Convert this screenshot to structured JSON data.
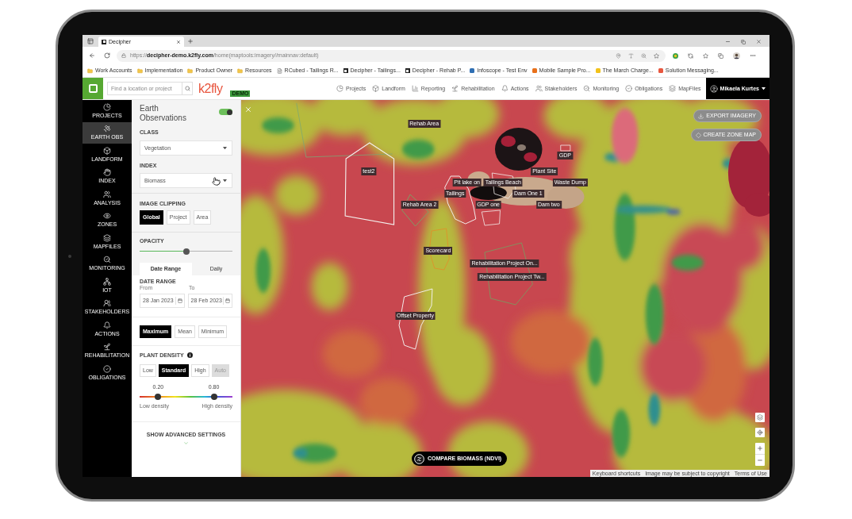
{
  "browser": {
    "tabs": [
      {
        "title": "Decipher",
        "selected": true
      }
    ],
    "url": "https://**decipher-demo.k2fly.com**/home(maptools:imagery//mainnav:default)",
    "bookmarks": [
      {
        "label": "Work Accounts",
        "kind": "folder"
      },
      {
        "label": "Implementation",
        "kind": "folder"
      },
      {
        "label": "Product Owner",
        "kind": "folder"
      },
      {
        "label": "Resources",
        "kind": "folder"
      },
      {
        "label": "RCubed - Tailings R...",
        "kind": "page"
      },
      {
        "label": "Decipher - Tailings...",
        "kind": "app"
      },
      {
        "label": "Decipher - Rehab P...",
        "kind": "app"
      },
      {
        "label": "Infoscope - Test Env",
        "kind": "favicon",
        "color": "#2f6fb3"
      },
      {
        "label": "Mobile Sample Pro...",
        "kind": "favicon",
        "color": "#e8701a"
      },
      {
        "label": "The March Charge...",
        "kind": "favicon",
        "color": "#f2c21b"
      },
      {
        "label": "Solution Messaging...",
        "kind": "favicon",
        "color": "#e8573f"
      }
    ]
  },
  "app_bar": {
    "search": {
      "placeholder": "Find a location or project"
    },
    "logo": "k2fly",
    "badge": "DEMO",
    "nav": [
      {
        "label": "Projects"
      },
      {
        "label": "Landform"
      },
      {
        "label": "Reporting"
      },
      {
        "label": "Rehabilitation"
      },
      {
        "label": "Actions"
      },
      {
        "label": "Stakeholders"
      },
      {
        "label": "Monitoring"
      },
      {
        "label": "Obligations"
      },
      {
        "label": "MapFiles"
      }
    ],
    "user": {
      "name": "Mikaela Kurtes"
    }
  },
  "sidebar": {
    "items": [
      {
        "label": "PROJECTS",
        "selected": false
      },
      {
        "label": "EARTH OBS",
        "selected": true
      },
      {
        "label": "LANDFORM",
        "selected": false
      },
      {
        "label": "INDEX",
        "selected": false
      },
      {
        "label": "ANALYSIS",
        "selected": false
      },
      {
        "label": "ZONES",
        "selected": false
      },
      {
        "label": "MAPFILES",
        "selected": false
      },
      {
        "label": "MONITORING",
        "selected": false
      },
      {
        "label": "IOT",
        "selected": false
      },
      {
        "label": "STAKEHOLDERS",
        "selected": false
      },
      {
        "label": "ACTIONS",
        "selected": false
      },
      {
        "label": "REHABILITATION",
        "selected": false
      },
      {
        "label": "OBLIGATIONS",
        "selected": false
      }
    ]
  },
  "panel": {
    "title": "Earth Observations",
    "enabled": true,
    "class_field": {
      "label": "CLASS",
      "value": "Vegetation"
    },
    "index_field": {
      "label": "INDEX",
      "value": "Biomass"
    },
    "image_clipping": {
      "label": "IMAGE CLIPPING",
      "options": [
        {
          "label": "Global",
          "selected": true
        },
        {
          "label": "Project",
          "selected": false
        },
        {
          "label": "Area",
          "selected": false
        }
      ]
    },
    "opacity": {
      "label": "OPACITY",
      "level": 0.5
    },
    "tabs": [
      {
        "label": "Date Range",
        "selected": true
      },
      {
        "label": "Daily",
        "selected": false
      }
    ],
    "date_range": {
      "label": "DATE RANGE",
      "from": {
        "label": "From",
        "value": "28 Jan 2023"
      },
      "to": {
        "label": "To",
        "value": "28 Feb 2023"
      }
    },
    "statistic": [
      {
        "label": "Maximum",
        "selected": true
      },
      {
        "label": "Mean",
        "selected": false
      },
      {
        "label": "Minimum",
        "selected": false
      }
    ],
    "plant_density": {
      "label": "PLANT DENSITY",
      "options": [
        {
          "label": "Low",
          "selected": false,
          "disabled": false
        },
        {
          "label": "Standard",
          "selected": true,
          "disabled": false
        },
        {
          "label": "High",
          "selected": false,
          "disabled": false
        },
        {
          "label": "Auto",
          "selected": false,
          "disabled": true
        }
      ],
      "range": {
        "low": {
          "level": 0.2,
          "reading": "0.20"
        },
        "high": {
          "level": 0.8,
          "reading": "0.80"
        },
        "min_label": "Low density",
        "max_label": "High density"
      }
    },
    "advanced": {
      "label": "SHOW ADVANCED SETTINGS",
      "expanded": false
    }
  },
  "map": {
    "labels": [
      {
        "text": "Rehab Area"
      },
      {
        "text": "GDP"
      },
      {
        "text": "test2"
      },
      {
        "text": "Plant Site"
      },
      {
        "text": "Pit lake on"
      },
      {
        "text": "Tailings Beach"
      },
      {
        "text": "Waste Dump"
      },
      {
        "text": "Tailings"
      },
      {
        "text": "Dam One 1"
      },
      {
        "text": "Rehab Area 2"
      },
      {
        "text": "GDP one"
      },
      {
        "text": "Dam two"
      },
      {
        "text": "Scorecard"
      },
      {
        "text": "Rehabilitation Project On..."
      },
      {
        "text": "Rehabilitation Project Tw..."
      },
      {
        "text": "Offset Property"
      }
    ],
    "actions": [
      {
        "label": "EXPORT IMAGERY"
      },
      {
        "label": "CREATE ZONE MAP"
      }
    ],
    "compare_button": {
      "label": "COMPARE BIOMASS (NDVI)"
    },
    "attribution": [
      "Keyboard shortcuts",
      "Image may be subject to copyright",
      "Terms of Use"
    ]
  }
}
